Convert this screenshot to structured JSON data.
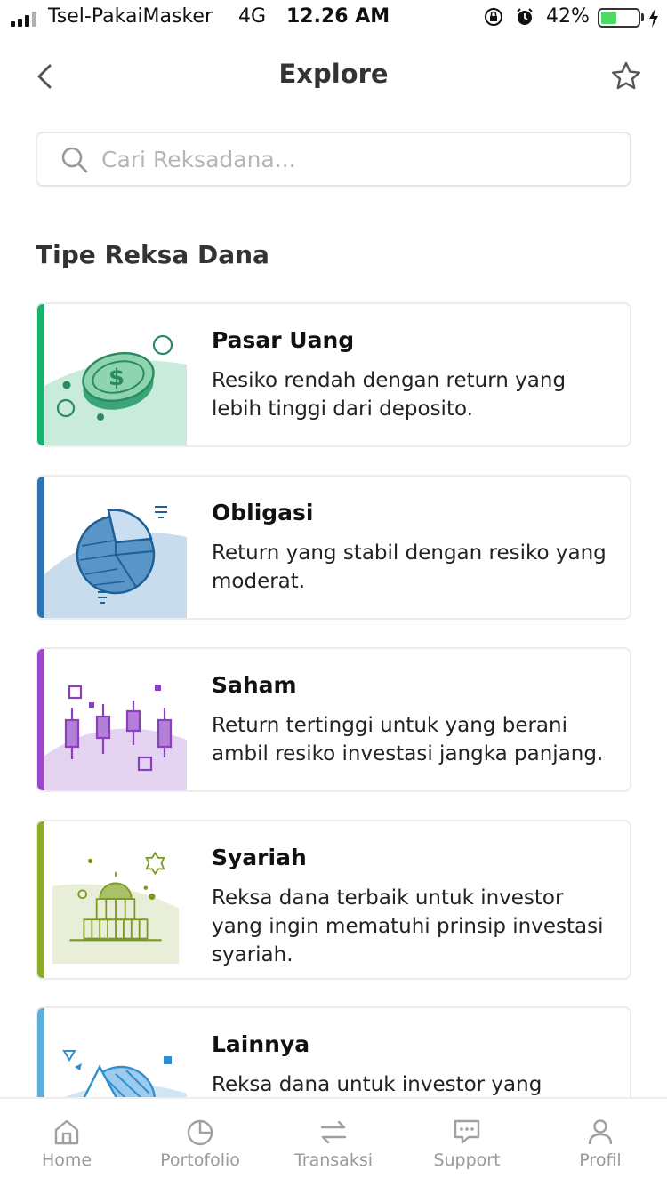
{
  "status_bar": {
    "carrier": "Tsel-PakaiMasker",
    "network": "4G",
    "time": "12.26 AM",
    "battery": "42%",
    "battery_level": 0.42
  },
  "header": {
    "title": "Explore",
    "back_icon": "chevron-left-icon",
    "favorite_icon": "star-icon"
  },
  "search": {
    "placeholder": "Cari Reksadana...",
    "value": ""
  },
  "section": {
    "title": "Tipe Reksa Dana"
  },
  "fund_types": [
    {
      "title": "Pasar Uang",
      "description": "Resiko rendah dengan return yang lebih tinggi dari deposito.",
      "accent": "#16b36e",
      "illustration": "coin-illustration"
    },
    {
      "title": "Obligasi",
      "description": "Return yang stabil dengan resiko yang moderat.",
      "accent": "#2d73b5",
      "illustration": "pie-chart-illustration"
    },
    {
      "title": "Saham",
      "description": "Return tertinggi untuk yang berani ambil resiko investasi jangka panjang.",
      "accent": "#9b47c9",
      "illustration": "candlestick-illustration"
    },
    {
      "title": "Syariah",
      "description": "Reksa dana terbaik untuk investor yang ingin mematuhi prinsip investasi syariah.",
      "accent": "#8daa28",
      "illustration": "mosque-illustration"
    },
    {
      "title": "Lainnya",
      "description": "Reksa dana untuk investor yang",
      "accent": "#5aaee0",
      "illustration": "shapes-illustration"
    }
  ],
  "bottom_nav": [
    {
      "label": "Home",
      "icon": "home-icon"
    },
    {
      "label": "Portofolio",
      "icon": "pie-chart-icon"
    },
    {
      "label": "Transaksi",
      "icon": "transfer-arrows-icon"
    },
    {
      "label": "Support",
      "icon": "chat-bubble-icon"
    },
    {
      "label": "Profil",
      "icon": "user-icon"
    }
  ],
  "colors": {
    "text_dark": "#333333",
    "nav_inactive": "#9a9a9a",
    "border": "#ececec"
  }
}
